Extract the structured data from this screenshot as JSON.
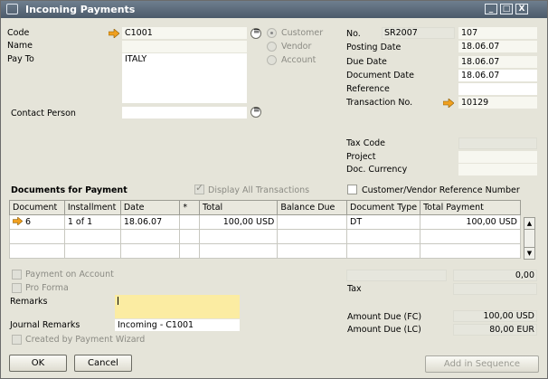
{
  "window": {
    "title": "Incoming Payments",
    "min_glyph": "_",
    "max_glyph": "□",
    "close_glyph": "X"
  },
  "header": {
    "code_label": "Code",
    "code_value": "C1001",
    "name_label": "Name",
    "name_value": "",
    "payto_label": "Pay To",
    "payto_value": "ITALY",
    "contact_label": "Contact Person",
    "contact_value": "",
    "radio_customer": "Customer",
    "radio_vendor": "Vendor",
    "radio_account": "Account",
    "no_label": "No.",
    "no_series": "SR2007",
    "no_value": "107",
    "posting_label": "Posting Date",
    "posting_value": "18.06.07",
    "due_label": "Due Date",
    "due_value": "18.06.07",
    "docdate_label": "Document Date",
    "docdate_value": "18.06.07",
    "ref_label": "Reference",
    "ref_value": "",
    "trans_label": "Transaction No.",
    "trans_value": "10129",
    "tax_code_label": "Tax Code",
    "project_label": "Project",
    "currency_label": "Doc. Currency"
  },
  "documents": {
    "section_label": "Documents for Payment",
    "display_all_label": "Display All Transactions",
    "cust_ref_label": "Customer/Vendor Reference Number",
    "columns": [
      "Document",
      "Installment",
      "Date",
      "*",
      "Total",
      "Balance Due",
      "Document Type",
      "Total Payment"
    ],
    "rows": [
      {
        "document": "6",
        "installment": "1 of 1",
        "date": "18.06.07",
        "star": "",
        "total": "100,00 USD",
        "balance": "",
        "type": "DT",
        "payment": "100,00 USD"
      }
    ]
  },
  "footer": {
    "payment_on_account_label": "Payment on Account",
    "pro_forma_label": "Pro Forma",
    "remarks_label": "Remarks",
    "remarks_value": "",
    "journal_label": "Journal Remarks",
    "journal_value": "Incoming - C1001",
    "wizard_label": "Created by Payment Wizard",
    "summary_value": "0,00",
    "tax_label": "Tax",
    "tax_value": "",
    "amount_fc_label": "Amount Due (FC)",
    "amount_fc_value": "100,00 USD",
    "amount_lc_label": "Amount Due (LC)",
    "amount_lc_value": "80,00 EUR"
  },
  "buttons": {
    "ok": "OK",
    "cancel": "Cancel",
    "add_in_sequence": "Add in Sequence"
  },
  "colors": {
    "accent_arrow": "#f0a020",
    "remarks_bg": "#fbeca2"
  }
}
